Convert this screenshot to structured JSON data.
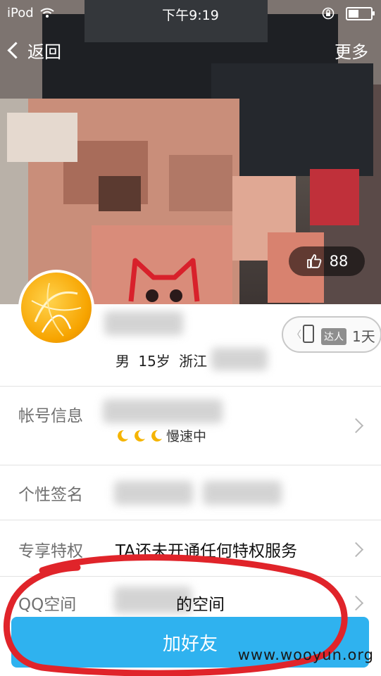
{
  "status_bar": {
    "carrier": "iPod",
    "time": "下午9:19"
  },
  "nav": {
    "back_label": "返回",
    "more_label": "更多"
  },
  "cover": {
    "likes": "88"
  },
  "profile": {
    "gender": "男",
    "age": "15岁",
    "location": "浙江",
    "badge_tag": "达人",
    "badge_days": "1天"
  },
  "rows": {
    "account": {
      "label": "帐号信息",
      "speed_text": "慢速中"
    },
    "signature": {
      "label": "个性签名"
    },
    "privilege": {
      "label": "专享特权",
      "value": "TA还未开通任何特权服务"
    },
    "qzone": {
      "label": "QQ空间",
      "value_suffix": "的空间"
    }
  },
  "actions": {
    "add_friend": "加好友"
  },
  "watermark": "www.wooyun.org",
  "colors": {
    "accent": "#2fb2ef",
    "annotation": "#e0242a"
  }
}
